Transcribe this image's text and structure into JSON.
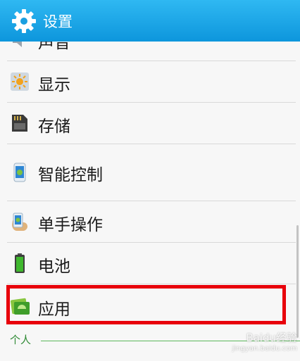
{
  "header": {
    "title": "设置",
    "icon": "gear-icon"
  },
  "items": [
    {
      "label": "声音",
      "icon": "speaker-icon"
    },
    {
      "label": "显示",
      "icon": "brightness-icon"
    },
    {
      "label": "存储",
      "icon": "sdcard-icon"
    },
    {
      "label": "智能控制",
      "icon": "phone-android-icon"
    },
    {
      "label": "单手操作",
      "icon": "hand-phone-icon"
    },
    {
      "label": "电池",
      "icon": "battery-icon"
    },
    {
      "label": "应用",
      "icon": "android-apps-icon"
    }
  ],
  "section": {
    "label": "个人"
  },
  "watermark": {
    "main": "Baidu经验",
    "sub": "jingyan.baidu.com"
  },
  "colors": {
    "header": "#0d96dc",
    "highlight": "#e8000b",
    "section": "#2f8a35"
  }
}
